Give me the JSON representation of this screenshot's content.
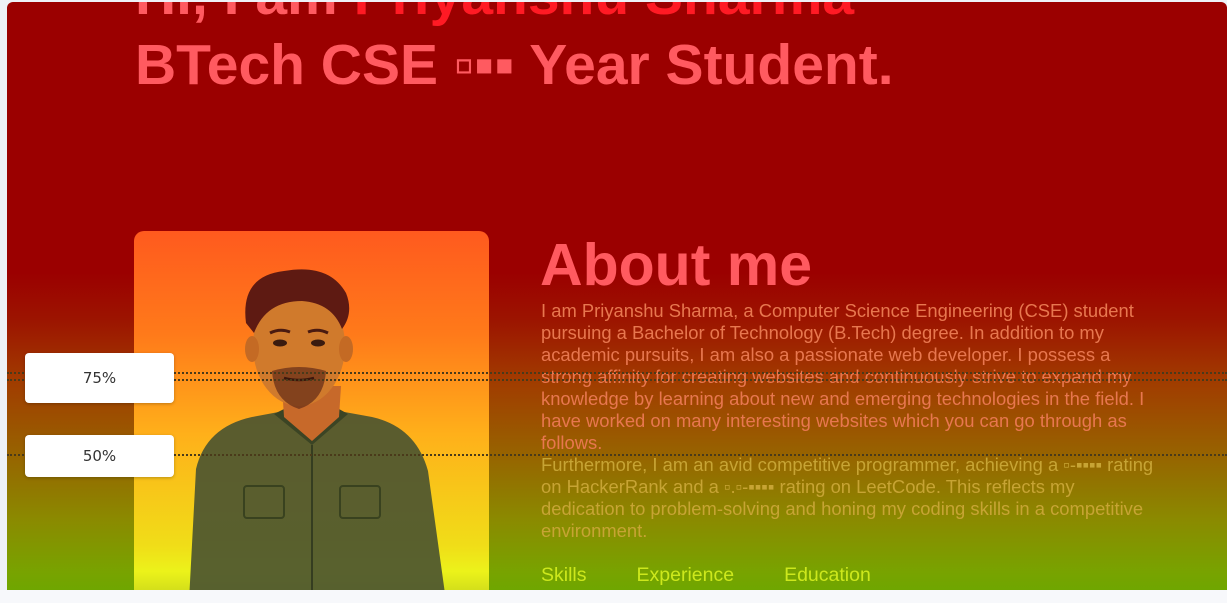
{
  "hero": {
    "line1_prefix": "Hi, I am ",
    "line1_name": "Priyanshu Sharma",
    "line2": "BTech CSE ▫▪▪ Year Student."
  },
  "about": {
    "title": "About me",
    "paragraph1": "I am Priyanshu Sharma, a Computer Science Engineering (CSE) student pursuing a Bachelor of Technology (B.Tech) degree. In addition to my academic pursuits, I am also a passionate web developer. I possess a strong affinity for creating websites and continuously strive to expand my knowledge by learning about new and emerging technologies in the field. I have worked on many interesting websites which you can go through as follows.",
    "paragraph2": "Furthermore, I am an avid competitive programmer, achieving a ▫-▪▪▪▪ rating on HackerRank and a ▫.▫-▪▪▪▪ rating on LeetCode. This reflects my dedication to problem-solving and honing my coding skills in a competitive environment."
  },
  "tabs": [
    "Skills",
    "Experience",
    "Education"
  ],
  "scroll_markers": [
    {
      "label": "75%"
    },
    {
      "label": "50%"
    }
  ],
  "colors": {
    "heatmap_top": "#9b0000",
    "heatmap_bottom": "#6fa600",
    "heading": "#ff5a60",
    "name_accent": "#ff1a24",
    "tab_link": "#cde81c"
  }
}
